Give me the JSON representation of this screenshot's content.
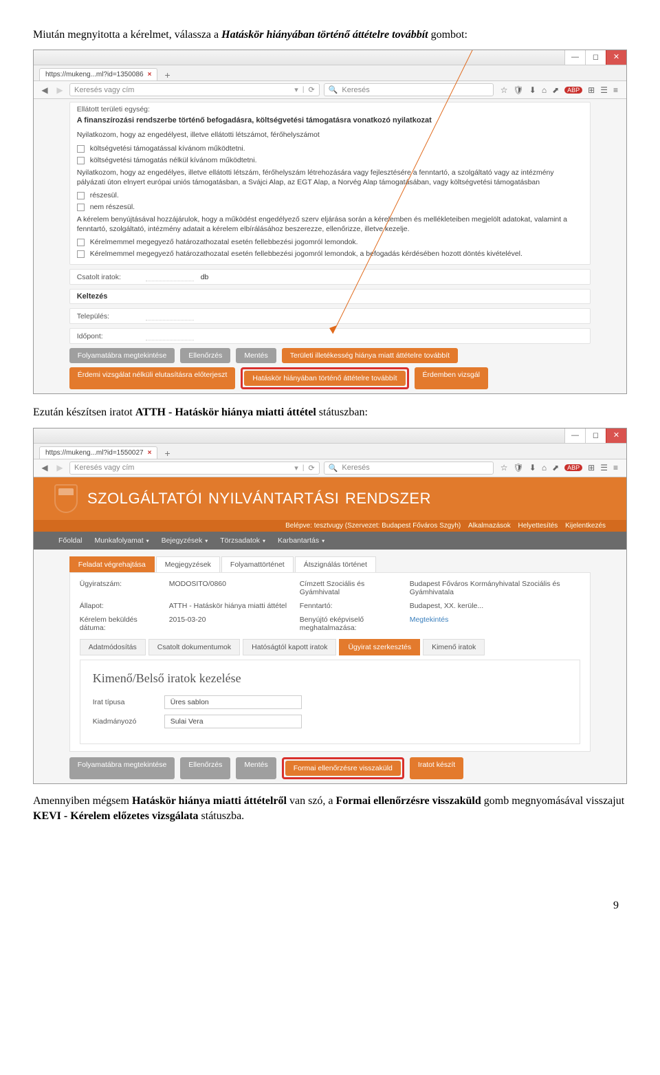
{
  "intro_before": "Miután megnyitotta a kérelmet, válassza a ",
  "intro_em": "Hatáskör hiányában történő áttételre továbbít",
  "intro_after": " gombot:",
  "shot1": {
    "tab_label": "https://mukeng...ml?id=1350086",
    "url_placeholder": "Keresés vagy cím",
    "reload_marker": "⟳",
    "search_placeholder": "Keresés",
    "toolbar_icons": [
      "☆",
      "🛡",
      "⬇",
      "⌂",
      "⬈",
      "ABP",
      "⊞",
      "☰",
      "≡"
    ],
    "header_line": "Ellátott területi egység:",
    "header_bold": "A finanszírozási rendszerbe történő befogadásra, költségvetési támogatásra vonatkozó nyilatkozat",
    "para1": "Nyilatkozom, hogy az engedélyest, illetve ellátotti létszámot, férőhelyszámot",
    "chk1": "költségvetési támogatással kívánom működtetni.",
    "chk2": "költségvetési támogatás nélkül kívánom működtetni.",
    "para2": "Nyilatkozom, hogy az engedélyes, illetve ellátotti létszám, férőhelyszám létrehozására vagy fejlesztésére a fenntartó, a szolgáltató vagy az intézmény pályázati úton elnyert európai uniós támogatásban, a Svájci Alap, az EGT Alap, a Norvég Alap támogatásában, vagy költségvetési támogatásban",
    "chk3": "részesül.",
    "chk4": "nem részesül.",
    "para3": "A kérelem benyújtásával hozzájárulok, hogy a működést engedélyező szerv eljárása során a kérelemben és mellékleteiben megjelölt adatokat, valamint a fenntartó, szolgáltató, intézmény adatait a kérelem elbírálásához beszerezze, ellenőrizze, illetve kezelje.",
    "chk5": "Kérelmemmel megegyező határozathozatal esetén fellebbezési jogomról lemondok.",
    "chk6": "Kérelmemmel megegyező határozathozatal esetén fellebbezési jogomról lemondok, a befogadás kérdésében hozott döntés kivételével.",
    "csatolt_label": "Csatolt iratok:",
    "csatolt_unit": "db",
    "keltezes": "Keltezés",
    "telepules": "Település:",
    "idopont": "Időpont:",
    "btns_row1": [
      "Folyamatábra megtekintése",
      "Ellenőrzés",
      "Mentés"
    ],
    "btn_teruleti": "Területi illetékesség hiánya miatt áttételre továbbít",
    "btn_erdemi_elut": "Érdemi vizsgálat nélküli elutasításra előterjeszt",
    "btn_hataskor": "Hatáskör hiányában történő áttételre továbbít",
    "btn_erdemben": "Érdemben vizsgál"
  },
  "midtext_before": "Ezután készítsen iratot ",
  "midtext_bold": "ATTH - Hatáskör hiánya miatti áttétel",
  "midtext_after": " státuszban:",
  "shot2": {
    "tab_label": "https://mukeng...ml?id=1550027",
    "url_placeholder": "Keresés vagy cím",
    "search_placeholder": "Keresés",
    "hero_title": "SZOLGÁLTATÓI NYILVÁNTARTÁSI RENDSZER",
    "login_text": "Belépve: tesztvugy (Szervezet: Budapest Főváros Szgyh)",
    "login_links": [
      "Alkalmazások",
      "Helyettesítés",
      "Kijelentkezés"
    ],
    "nav": [
      "Főoldal",
      "Munkafolyamat",
      "Bejegyzések",
      "Törzsadatok",
      "Karbantartás"
    ],
    "tabs_main": [
      "Feladat végrehajtása",
      "Megjegyzések",
      "Folyamattörténet",
      "Átszignálás történet"
    ],
    "ugyiratszam_l": "Ügyiratszám:",
    "ugyiratszam_v": "MODOSITO/0860",
    "cimzett_l": "Címzett Szociális és Gyámhivatal",
    "cimzett_v": "Budapest Főváros Kormányhivatal Szociális és Gyámhivatala",
    "allapot_l": "Állapot:",
    "allapot_v": "ATTH - Hatáskör hiánya miatti áttétel",
    "fenntarto_l": "Fenntartó:",
    "fenntarto_v": "Budapest, XX. kerüle...",
    "datum_l": "Kérelem beküldés dátuma:",
    "datum_v": "2015-03-20",
    "benyujto_l": "Benyújtó eképviselő meghatalmazása:",
    "benyujto_v": "Megtekintés",
    "subtabs": [
      "Adatmódosítás",
      "Csatolt dokumentumok",
      "Hatóságtól kapott iratok",
      "Ügyirat szerkesztés",
      "Kimenő iratok"
    ],
    "panel_title": "Kimenő/Belső iratok kezelése",
    "irattipus_l": "Irat típusa",
    "irattipus_v": "Üres sablon",
    "kiadmanyozo_l": "Kiadmányozó",
    "kiadmanyozo_v": "Sulai Vera",
    "btns2_row": [
      "Folyamatábra megtekintése",
      "Ellenőrzés",
      "Mentés"
    ],
    "btn_formai": "Formai ellenőrzésre visszaküld",
    "btn_irat": "Iratot készít"
  },
  "closing_before": "Amennyiben mégsem ",
  "closing_b1": "Hatáskör hiánya miatti áttételről",
  "closing_mid1": " van szó, a ",
  "closing_b2": "Formai ellenőrzésre visszaküld",
  "closing_mid2": " gomb megnyomásával visszajut ",
  "closing_b3": "KEVI - Kérelem előzetes vizsgálata",
  "closing_after": " státuszba.",
  "page_number": "9"
}
